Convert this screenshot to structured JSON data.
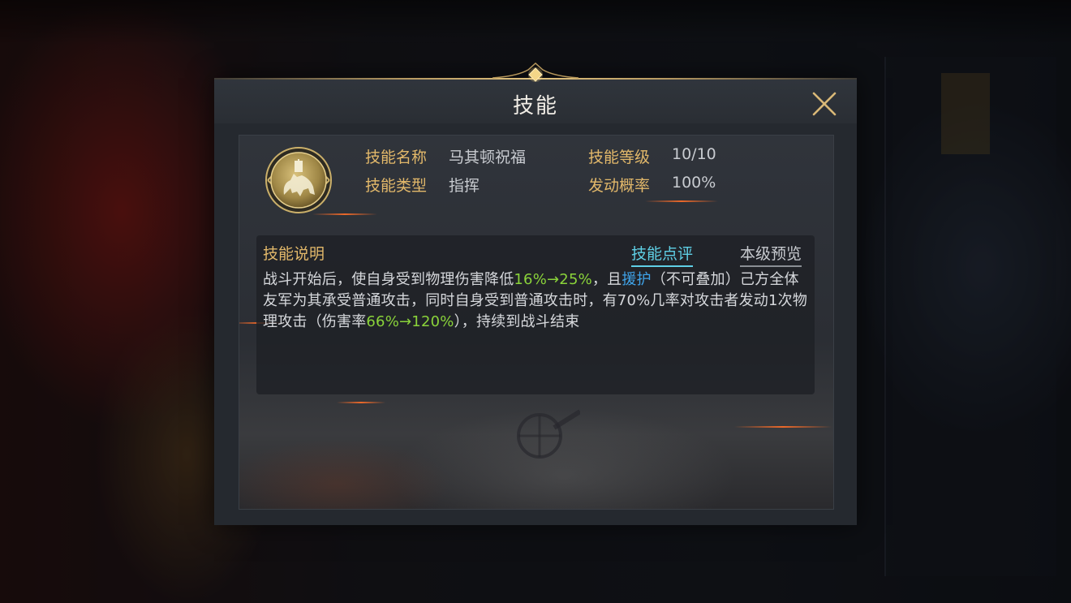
{
  "dialog": {
    "title": "技能",
    "close_icon": "close-icon"
  },
  "skill": {
    "icon": "cavalry-emblem-icon",
    "name_label": "技能名称",
    "name_value": "马其顿祝福",
    "level_label": "技能等级",
    "level_value": "10/10",
    "type_label": "技能类型",
    "type_value": "指挥",
    "chance_label": "发动概率",
    "chance_value": "100%"
  },
  "description": {
    "header": "技能说明",
    "tab_review": "技能点评",
    "tab_preview": "本级预览",
    "segments": {
      "s1": "战斗开始后，使自身受到物理伤害降低",
      "s2": "16%→25%",
      "s3": "，且",
      "s4": "援护",
      "s5": "（不可叠加）己方全体友军为其承受普通攻击，同时自身受到普通攻击时，有70%几率对攻击者发动1次物理攻击（伤害率",
      "s6": "66%→120%",
      "s7": "），持续到战斗结束"
    }
  },
  "colors": {
    "label_gold": "#e2b86a",
    "highlight_green": "#8ad33a",
    "keyword_blue": "#3fa4ea",
    "tab_active": "#5fd0e6"
  }
}
